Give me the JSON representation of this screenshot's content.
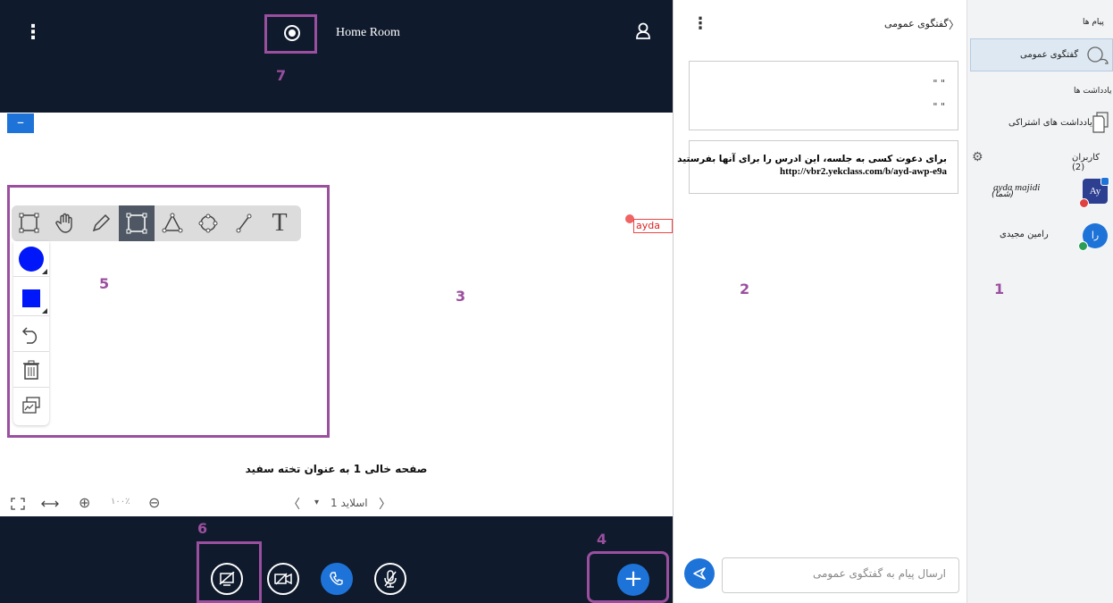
{
  "header": {
    "room_title": "Home Room",
    "menu_icon": "kebab-icon",
    "record_icon": "record-icon",
    "user_icon": "user-icon"
  },
  "annotations": {
    "n1": "1",
    "n2": "2",
    "n3": "3",
    "n4": "4",
    "n5": "5",
    "n6": "6",
    "n7": "7"
  },
  "whiteboard": {
    "minimize_label": "–",
    "cursor_label": "ayda m",
    "slide_caption": "صفحه خالی 1 به عنوان تخته سفید",
    "tools": [
      "selection-icon",
      "hand-icon",
      "pencil-icon",
      "rectangle-icon",
      "triangle-icon",
      "ellipse-icon",
      "line-icon",
      "text-icon"
    ],
    "side_tools": [
      "color-fill-icon",
      "color-stroke-icon",
      "undo-icon",
      "trash-icon",
      "multi-user-icon"
    ],
    "color_fill": "#0018f9",
    "color_stroke": "#0018f9",
    "text_tool_label": "T"
  },
  "slide_controls": {
    "fit_icon": "fit-screen-icon",
    "width_icon": "fit-width-icon",
    "zoom_in": "⊕",
    "zoom_level": "۱۰۰٪",
    "zoom_out": "⊖",
    "prev": "〈",
    "slide_label": "اسلاید 1",
    "dropdown": "▾",
    "next": "〉"
  },
  "actions": {
    "add_label": "+",
    "accent": "#1e73d8"
  },
  "chat": {
    "header": "گفتگوی عمومی",
    "back_icon": "chevron-right-icon",
    "quote_line1": "\" \"",
    "quote_line2": "\" \"",
    "invite_text": "برای دعوت کسی به جلسه، این ادرس را برای آنها بفرستید",
    "invite_url": "http://vbr2.yekclass.com/b/ayd-awp-e9a",
    "input_placeholder": "ارسال پیام به گفتگوی عمومی"
  },
  "users_panel": {
    "messages_title": "پیام ها",
    "public_chat": "گفتگوی عمومی",
    "notes_title": "یادداشت ها",
    "shared_notes": "یادداشت های اشتراکی",
    "users_title": "کاربران (2)",
    "users": [
      {
        "name": "ayda majidi",
        "you": "(شما)",
        "initials": "Ay",
        "color": "#2c3f91"
      },
      {
        "name": "رامین مجیدی",
        "you": "",
        "initials": "را",
        "color": "#1e73d8"
      }
    ]
  }
}
